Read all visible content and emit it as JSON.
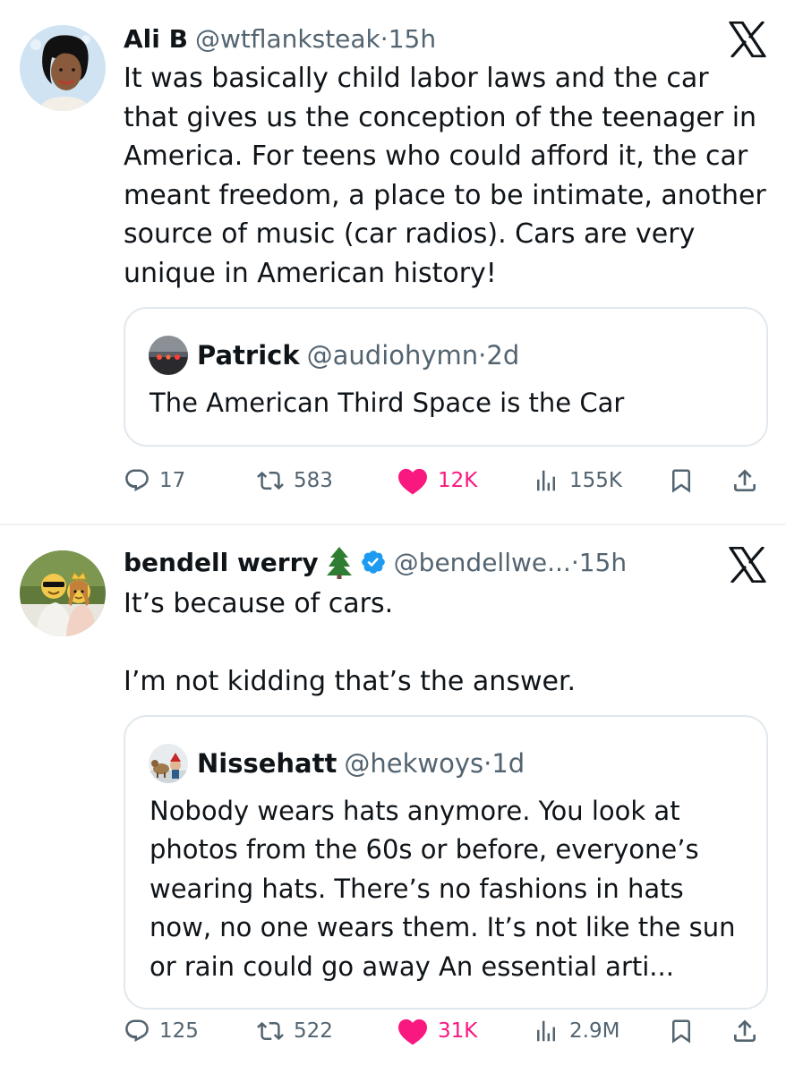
{
  "tweets": [
    {
      "author": {
        "name": "Ali B",
        "handle": "@wtflanksteak",
        "separator": "·",
        "time": "15h"
      },
      "text": "It was basically child labor laws and the car that gives us the conception of the teenager in America. For teens who could afford it, the car meant freedom, a place to be intimate, another source of music (car radios). Cars are very unique in American history!",
      "quote": {
        "name": "Patrick",
        "handle": "@audiohymn",
        "separator": "·",
        "time": "2d",
        "text": "The American Third Space is the Car"
      },
      "stats": {
        "replies": "17",
        "reposts": "583",
        "likes": "12K",
        "views": "155K"
      }
    },
    {
      "author": {
        "name": "bendell werry",
        "emoji": "🌲",
        "verified": true,
        "handle": "@bendellwe...",
        "separator": "·",
        "time": "15h"
      },
      "text": "It’s because of cars.\n\nI’m not kidding that’s the answer.",
      "quote": {
        "name": "Nissehatt",
        "handle": "@hekwoys",
        "separator": "·",
        "time": "1d",
        "text": "Nobody wears hats anymore. You look at photos from the 60s or before, everyone’s wearing hats. There’s no fashions in hats now, no one wears them. It’s not like the sun or rain could go away An essential arti..."
      },
      "stats": {
        "replies": "125",
        "reposts": "522",
        "likes": "31K",
        "views": "2.9M"
      }
    }
  ],
  "colors": {
    "text": "#0f1419",
    "secondary": "#536471",
    "like": "#f91880",
    "verified": "#1d9bf0",
    "border": "#e1e8ed"
  }
}
